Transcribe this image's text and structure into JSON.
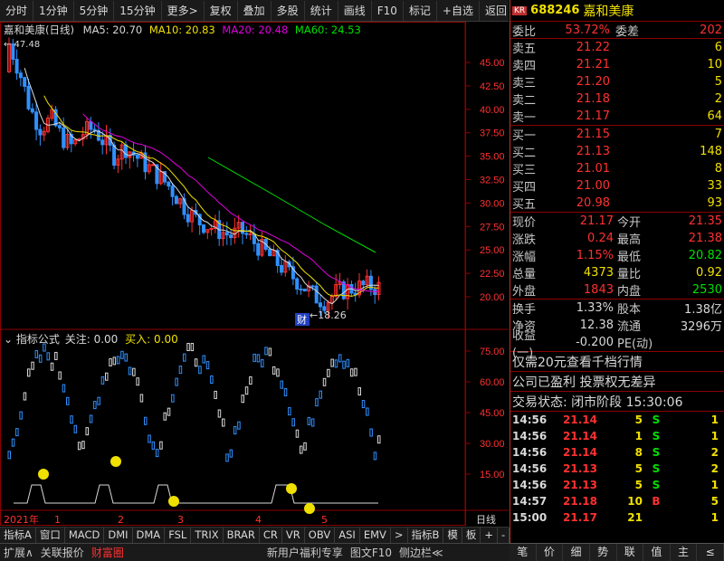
{
  "toolbar": {
    "items": [
      "分时",
      "1分钟",
      "5分钟",
      "15分钟",
      "更多>",
      "复权",
      "叠加",
      "多股",
      "统计",
      "画线",
      "F10",
      "标记",
      "+自选",
      "返回"
    ]
  },
  "chart": {
    "stock_label": "嘉和美康(日线)",
    "ma5": "MA5: 20.70",
    "ma10": "MA10: 20.83",
    "ma20": "MA20: 20.48",
    "ma60": "MA60: 24.53",
    "high_mark": "47.48",
    "low_mark": "18.26",
    "cai_label": "财",
    "price_ticks": [
      "45.00",
      "42.50",
      "40.00",
      "37.50",
      "35.00",
      "32.50",
      "30.00",
      "27.50",
      "25.00",
      "22.50",
      "20.00"
    ],
    "indicator_title": "指标公式",
    "focus": "关注: 0.00",
    "buy": "买入: 0.00",
    "ind_ticks": [
      "75.00",
      "60.00",
      "45.00",
      "30.00",
      "15.00"
    ],
    "date_row": {
      "year": "2021年",
      "months": [
        "1",
        "2",
        "3",
        "4",
        "5"
      ],
      "right": "日线"
    },
    "colors": {
      "ma5": "#d8d8d8",
      "ma10": "#f0e000",
      "ma20": "#e000e0",
      "ma60": "#00e000",
      "up": "#ff3030",
      "down": "#3090ff"
    }
  },
  "tabs": [
    "指标A",
    "窗口",
    "MACD",
    "DMI",
    "DMA",
    "FSL",
    "TRIX",
    "BRAR",
    "CR",
    "VR",
    "OBV",
    "ASI",
    "EMV",
    ">",
    "指标B",
    "模",
    "板",
    "+",
    "-"
  ],
  "status": {
    "items": [
      "扩展∧",
      "关联报价",
      "财富圈",
      "新用户福利专享",
      "图文F10",
      "侧边栏≪"
    ]
  },
  "quote": {
    "kr": "KR",
    "code": "688246",
    "name": "嘉和美康",
    "webi": {
      "label": "委比",
      "value": "53.72%",
      "label2": "委差",
      "value2": "202"
    },
    "asks": [
      {
        "label": "卖五",
        "price": "21.22",
        "vol": "6"
      },
      {
        "label": "卖四",
        "price": "21.21",
        "vol": "10"
      },
      {
        "label": "卖三",
        "price": "21.20",
        "vol": "5"
      },
      {
        "label": "卖二",
        "price": "21.18",
        "vol": "2"
      },
      {
        "label": "卖一",
        "price": "21.17",
        "vol": "64"
      }
    ],
    "bids": [
      {
        "label": "买一",
        "price": "21.15",
        "vol": "7"
      },
      {
        "label": "买二",
        "price": "21.13",
        "vol": "148"
      },
      {
        "label": "买三",
        "price": "21.01",
        "vol": "8"
      },
      {
        "label": "买四",
        "price": "21.00",
        "vol": "33"
      },
      {
        "label": "买五",
        "price": "20.98",
        "vol": "93"
      }
    ],
    "stats": [
      {
        "l1": "现价",
        "v1": "21.17",
        "l2": "今开",
        "v2": "21.35"
      },
      {
        "l1": "涨跌",
        "v1": "0.24",
        "l2": "最高",
        "v2": "21.38"
      },
      {
        "l1": "涨幅",
        "v1": "1.15%",
        "l2": "最低",
        "v2": "20.82"
      },
      {
        "l1": "总量",
        "v1": "4373",
        "l2": "量比",
        "v2": "0.92"
      },
      {
        "l1": "外盘",
        "v1": "1843",
        "l2": "内盘",
        "v2": "2530"
      }
    ],
    "stats2": [
      {
        "l1": "换手",
        "v1": "1.33%",
        "l2": "股本",
        "v2": "1.38亿"
      },
      {
        "l1": "净资",
        "v1": "12.38",
        "l2": "流通",
        "v2": "3296万"
      },
      {
        "l1": "收益(一)",
        "v1": "-0.200",
        "l2": "PE(动)",
        "v2": ""
      }
    ],
    "notes": [
      "仅需20元查看千档行情",
      "公司已盈利 投票权无差异"
    ],
    "trade_state": "交易状态: 闭市阶段 15:30:06",
    "ticks": [
      {
        "t": "14:56",
        "p": "21.14",
        "n": "5",
        "d": "S",
        "c": "1"
      },
      {
        "t": "14:56",
        "p": "21.14",
        "n": "1",
        "d": "S",
        "c": "1"
      },
      {
        "t": "14:56",
        "p": "21.14",
        "n": "8",
        "d": "S",
        "c": "2"
      },
      {
        "t": "14:56",
        "p": "21.13",
        "n": "5",
        "d": "S",
        "c": "2"
      },
      {
        "t": "14:56",
        "p": "21.13",
        "n": "5",
        "d": "S",
        "c": "1"
      },
      {
        "t": "14:57",
        "p": "21.18",
        "n": "10",
        "d": "B",
        "c": "5"
      },
      {
        "t": "15:00",
        "p": "21.17",
        "n": "21",
        "d": "",
        "c": "1"
      }
    ],
    "bottom_icons": [
      "笔",
      "价",
      "细",
      "势",
      "联",
      "值",
      "主",
      "≤"
    ]
  }
}
